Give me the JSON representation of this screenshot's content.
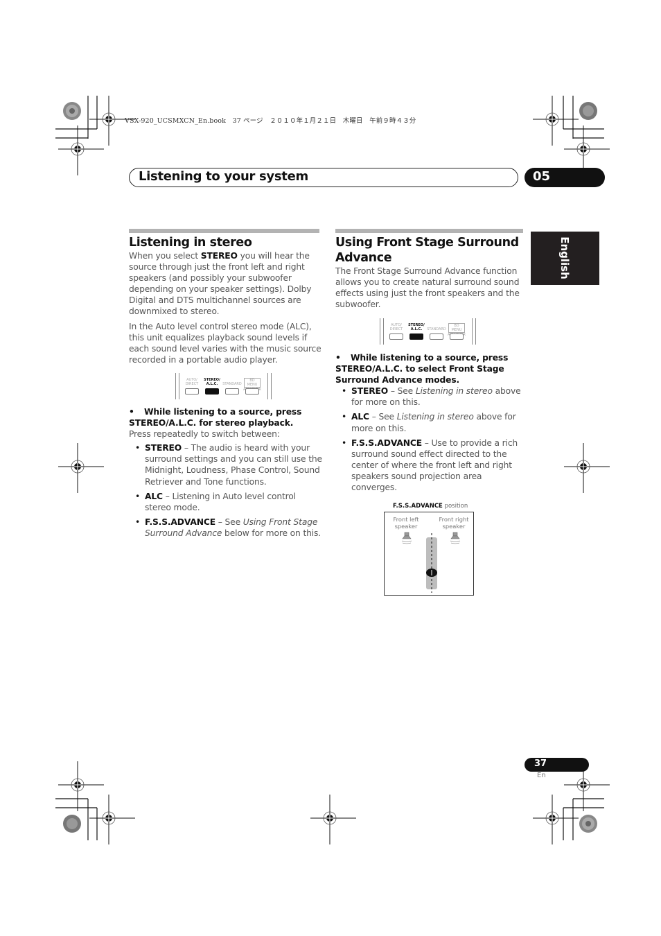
{
  "print_header": "VSX-920_UCSMXCN_En.book　37 ページ　２０１０年１月２１日　木曜日　午前９時４３分",
  "chapter": {
    "title": "Listening to your system",
    "number": "05"
  },
  "language_tab": "English",
  "left_section": {
    "heading": "Listening in stereo",
    "intro": {
      "pre": "When you select ",
      "bold": "STEREO",
      "post": " you will hear the source through just the front left and right speakers (and possibly your subwoofer depending on your speaker settings). Dolby Digital and DTS multichannel sources are downmixed to stereo."
    },
    "alc_paragraph": "In the Auto level control stereo mode (ALC), this unit equalizes playback sound levels if each sound level varies with the music source recorded in a portable audio player.",
    "instruction": {
      "bullet": "•",
      "text": "While listening to a source, press STEREO/A.L.C. for stereo playback."
    },
    "press_note": "Press repeatedly to switch between:",
    "modes": [
      {
        "name": "STEREO",
        "desc": " – The audio is heard with your surround settings and you can still use the Midnight, Loudness, Phase Control, Sound Retriever and Tone functions."
      },
      {
        "name": "ALC",
        "desc": " – Listening in Auto level control stereo mode."
      },
      {
        "name": "F.S.S.ADVANCE",
        "desc_pre": " – See ",
        "desc_italic": "Using Front Stage Surround Advance",
        "desc_post": " below for more on this."
      }
    ]
  },
  "right_section": {
    "heading": "Using Front Stage Surround Advance",
    "intro": "The Front Stage Surround Advance function allows you to create natural surround sound effects using just the front speakers and the subwoofer.",
    "instruction": {
      "bullet": "•",
      "text": "While listening to a source, press STEREO/A.L.C. to select Front Stage Surround Advance modes."
    },
    "modes": [
      {
        "name": "STEREO",
        "desc_pre": " – See ",
        "desc_italic": "Listening in stereo",
        "desc_post": " above for more on this."
      },
      {
        "name": "ALC",
        "desc_pre": " – See ",
        "desc_italic": "Listening in stereo",
        "desc_post": " above for more on this."
      },
      {
        "name": "F.S.S.ADVANCE",
        "desc": " – Use to provide a rich surround sound effect directed to the center of where the front left and right speakers sound projection area converges."
      }
    ],
    "diagram": {
      "caption_bold": "F.S.S.ADVANCE",
      "caption_rest": " position",
      "left_speaker": "Front left speaker",
      "right_speaker": "Front right speaker"
    }
  },
  "front_panel": {
    "buttons": [
      {
        "top": "AUTO/",
        "bottom": "DIRECT",
        "active": false
      },
      {
        "top": "STEREO/",
        "bottom": "A.L.C.",
        "active": true
      },
      {
        "top": "",
        "bottom": "STANDARD",
        "active": false
      },
      {
        "top": "BD MENU",
        "bottom": "ADV SURR",
        "active": false
      }
    ]
  },
  "footer": {
    "page": "37",
    "lang": "En"
  }
}
